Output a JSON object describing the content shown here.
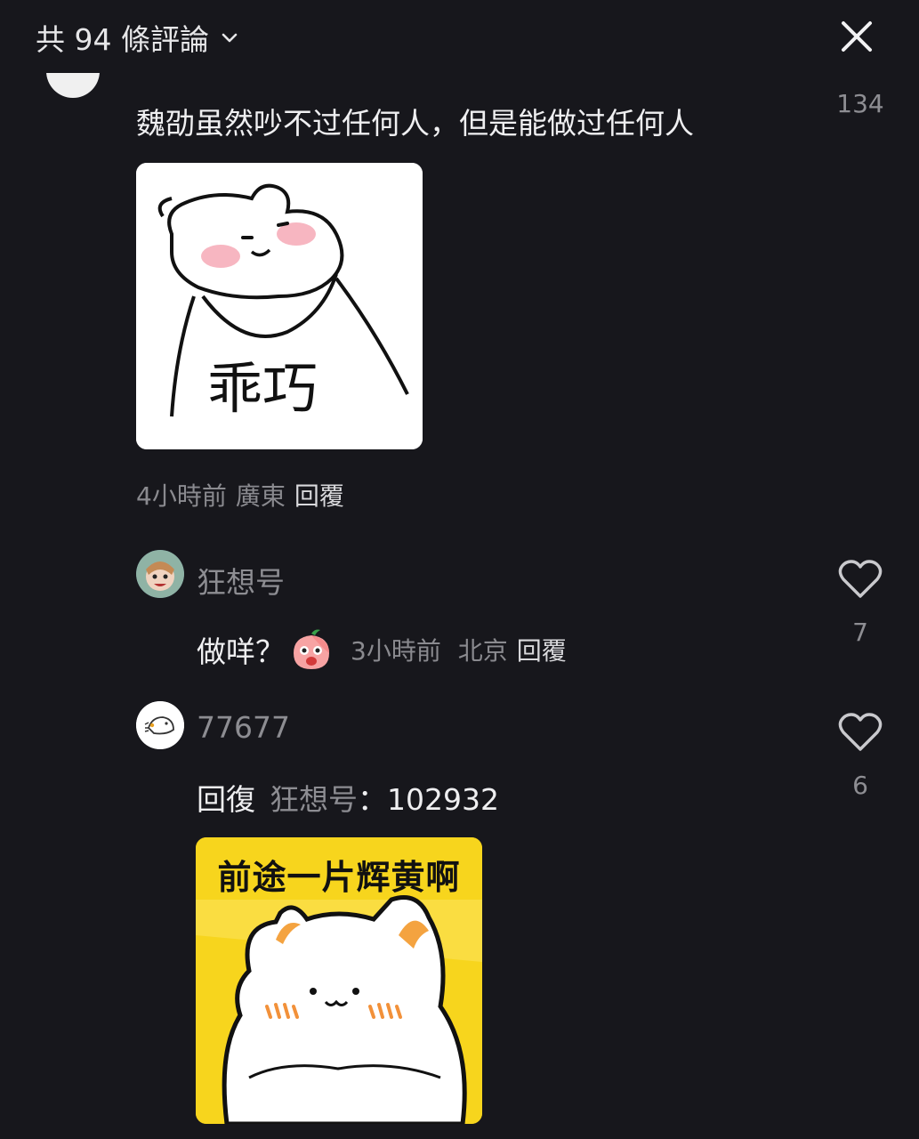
{
  "header": {
    "title": "共 94 條評論",
    "chevron_icon": "chevron-down-icon",
    "close_icon": "close-icon"
  },
  "main_comment": {
    "text": "魏劭虽然吵不过任何人，但是能做过任何人",
    "like_count": "134",
    "sticker_text": "乖巧",
    "time": "4小時前",
    "location": "廣東",
    "reply_label": "回覆"
  },
  "replies": [
    {
      "username": "狂想号",
      "text": "做咩？",
      "emoji": "peach-face-emoji",
      "time": "3小時前",
      "location": "北京",
      "reply_label": "回覆",
      "like_count": "7"
    },
    {
      "username": "77677",
      "prefix": "回復",
      "mention": "狂想号",
      "text": "：102932",
      "sticker_text": "前途一片辉黄啊",
      "like_count": "6"
    }
  ],
  "colors": {
    "background": "#17171c",
    "text": "#efeff1",
    "muted": "#8d8d92",
    "sticker_yellow": "#f7d51d"
  }
}
